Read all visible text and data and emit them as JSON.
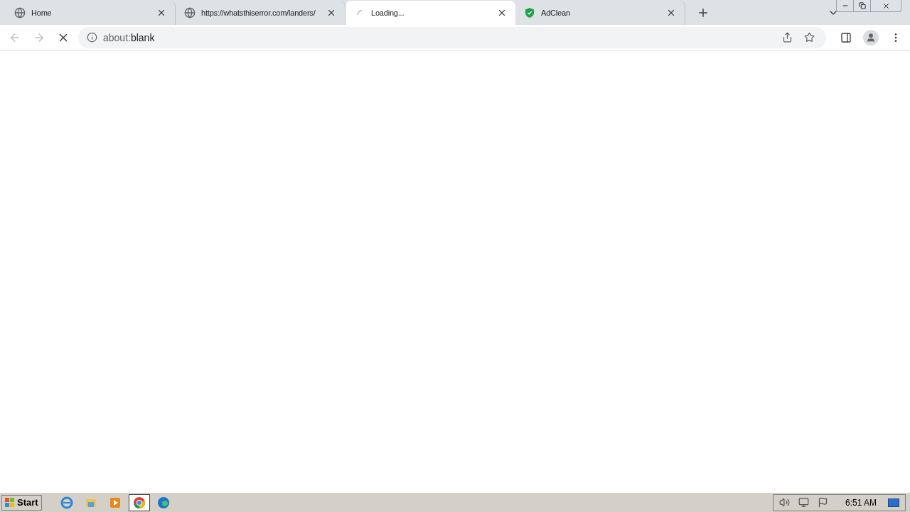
{
  "tabs": [
    {
      "kind": "globe",
      "title": "Home",
      "selected": false
    },
    {
      "kind": "globe",
      "title": "https://whatsthiserror.com/landers/",
      "selected": false
    },
    {
      "kind": "loading",
      "title": "Loading...",
      "selected": true
    },
    {
      "kind": "shield",
      "title": "AdClean",
      "selected": false
    }
  ],
  "toolbar": {
    "loading": true,
    "address_scheme": "about:",
    "address_rest": "blank"
  },
  "taskbar": {
    "start_label": "Start",
    "items": [
      {
        "kind": "ie",
        "selected": false
      },
      {
        "kind": "folder",
        "selected": false
      },
      {
        "kind": "media",
        "selected": false
      },
      {
        "kind": "chrome",
        "selected": true
      },
      {
        "kind": "edge",
        "selected": false
      }
    ],
    "clock": "6:51 AM"
  }
}
